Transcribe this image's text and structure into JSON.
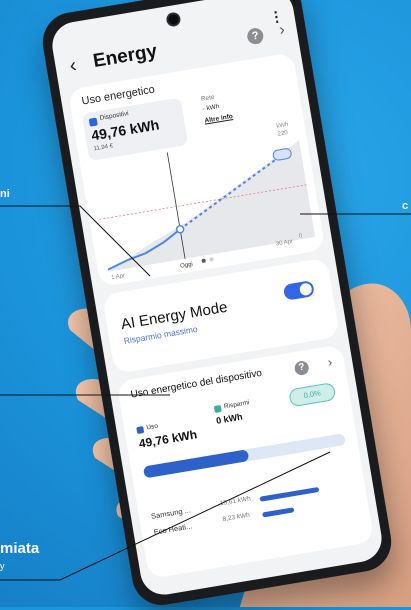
{
  "callouts": {
    "top_left": "ni",
    "top_right": "c",
    "bottom_title": "miata",
    "bottom_sub": "y"
  },
  "app": {
    "title": "Energy",
    "help": "?"
  },
  "usage": {
    "section_title": "Uso energetico",
    "device_label": "Dispositivi",
    "device_value": "49,76 kWh",
    "device_price": "11,94 €",
    "grid_label": "Rete",
    "grid_value": "- kWh",
    "grid_link": "Altre info",
    "chart_unit": "kWh",
    "y_max": "220",
    "y_min": "0",
    "x_start": "1 Apr",
    "x_end": "30 Apr",
    "today": "Oggi"
  },
  "ai_mode": {
    "title": "AI Energy Mode",
    "subtitle": "Risparmio massimo",
    "enabled": true
  },
  "device_usage": {
    "title": "Uso energetico del dispositivo",
    "help": "?",
    "use_label": "Uso",
    "use_value": "49,76 kWh",
    "saving_label": "Risparmi",
    "saving_value": "0 kWh",
    "saving_badge": "0,0%",
    "bar_fill_fraction": 0.52,
    "devices": [
      {
        "name": "Samsung ...",
        "value": "15,61 kWh",
        "fraction": 0.3
      },
      {
        "name": "Eco Heati...",
        "value": "8,23 kWh",
        "fraction": 0.16
      }
    ]
  },
  "colors": {
    "background": "#1a96de",
    "accent": "#3467e6",
    "saving": "#3cae9e"
  }
}
